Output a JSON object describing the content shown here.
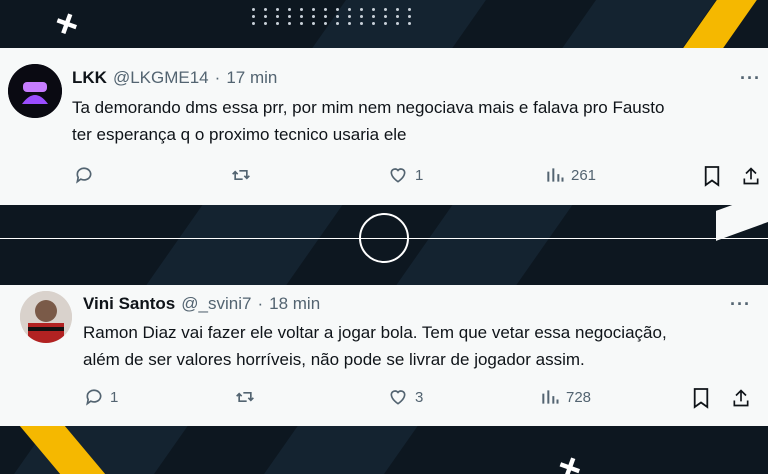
{
  "tweets": [
    {
      "name": "LKK",
      "handle": "@LKGME14",
      "dot": "·",
      "time": "17 min",
      "text_lines": [
        "Ta demorando dms essa prr, por mim nem negociava mais e falava pro Fausto",
        "ter esperança q o proximo tecnico usaria ele"
      ],
      "replies": "",
      "retweets": "",
      "likes": "1",
      "views": "261",
      "more": "···"
    },
    {
      "name": "Vini Santos",
      "handle": "@_svini7",
      "dot": "·",
      "time": "18 min",
      "text_lines": [
        "Ramon Diaz vai fazer ele voltar a jogar bola. Tem que vetar essa negociação,",
        "além de ser valores horríveis, não pode se livrar de jogador assim."
      ],
      "replies": "1",
      "retweets": "",
      "likes": "3",
      "views": "728",
      "more": "···"
    }
  ],
  "colors": {
    "background": "#0d1720",
    "accent_yellow": "#f5b800",
    "card": "#f7f9f9",
    "text": "#0f1419",
    "muted": "#536471"
  }
}
